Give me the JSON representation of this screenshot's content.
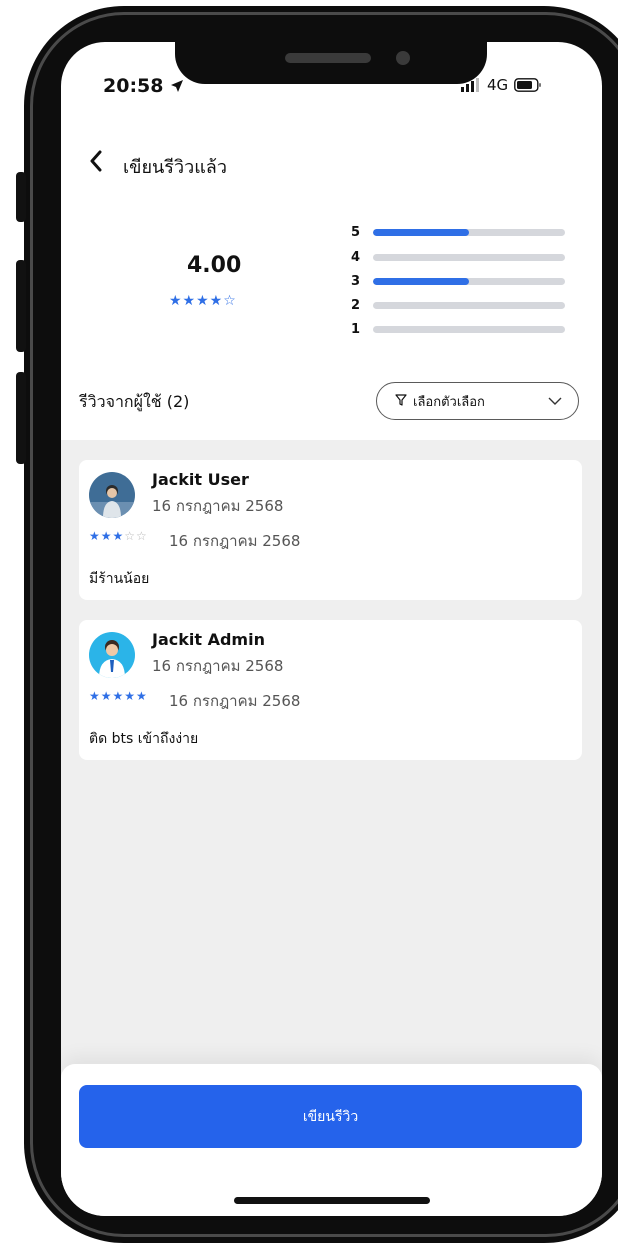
{
  "status": {
    "time": "20:58",
    "network": "4G"
  },
  "header": {
    "title": "เขียนรีวิวแล้ว"
  },
  "rating": {
    "average": "4.00",
    "stars": "★★★★☆",
    "distribution": [
      {
        "label": "5",
        "fraction": 0.5
      },
      {
        "label": "4",
        "fraction": 0
      },
      {
        "label": "3",
        "fraction": 0.5
      },
      {
        "label": "2",
        "fraction": 0
      },
      {
        "label": "1",
        "fraction": 0
      }
    ]
  },
  "reviews": {
    "title": "รีวิวจากผู้ใช้ (2)",
    "filter_label": "เลือกตัวเลือก",
    "items": [
      {
        "name": "Jackit User",
        "date": "16 กรกฎาคม 2568",
        "stars_on": "★★★",
        "stars_off": "☆☆",
        "review_date": "16 กรกฎาคม 2568",
        "text": "มีร้านน้อย",
        "rating": 3
      },
      {
        "name": "Jackit Admin",
        "date": "16 กรกฎาคม 2568",
        "stars_on": "★★★★★",
        "stars_off": "",
        "review_date": "16 กรกฎาคม 2568",
        "text": "ติด bts เข้าถึงง่าย",
        "rating": 5
      }
    ]
  },
  "footer": {
    "write_button": "เขียนรีวิว"
  },
  "colors": {
    "accent": "#2f6fe6",
    "button": "#2563eb",
    "list_bg": "#efefef"
  }
}
